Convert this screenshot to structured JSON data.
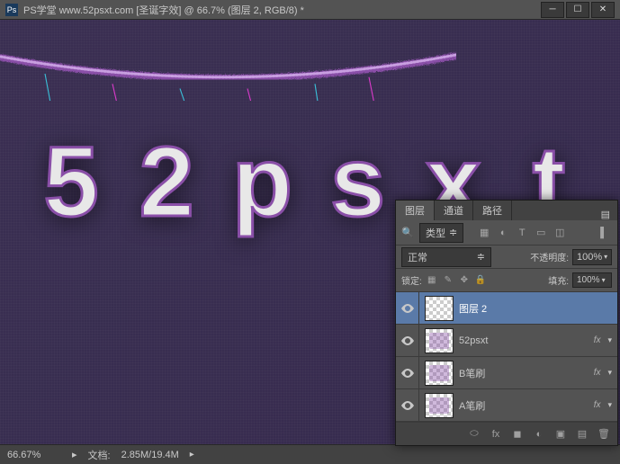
{
  "titlebar": {
    "app_icon": "Ps",
    "title": "PS学堂  www.52psxt.com [圣诞字效] @ 66.7% (图层 2, RGB/8) *"
  },
  "canvas": {
    "text": "52psxt"
  },
  "statusbar": {
    "zoom": "66.67%",
    "doc_label": "文档:",
    "doc_size": "2.85M/19.4M"
  },
  "layers_panel": {
    "tabs": {
      "layers": "图层",
      "channels": "通道",
      "paths": "路径"
    },
    "type_filter_label": "类型",
    "blend_mode": "正常",
    "opacity_label": "不透明度:",
    "opacity_value": "100%",
    "lock_label": "锁定:",
    "fill_label": "填充:",
    "fill_value": "100%",
    "layers": [
      {
        "name": "图层 2",
        "selected": true,
        "fx": false
      },
      {
        "name": "52psxt",
        "selected": false,
        "fx": true
      },
      {
        "name": "B笔刷",
        "selected": false,
        "fx": true
      },
      {
        "name": "A笔刷",
        "selected": false,
        "fx": true
      }
    ],
    "fx_text": "fx"
  }
}
